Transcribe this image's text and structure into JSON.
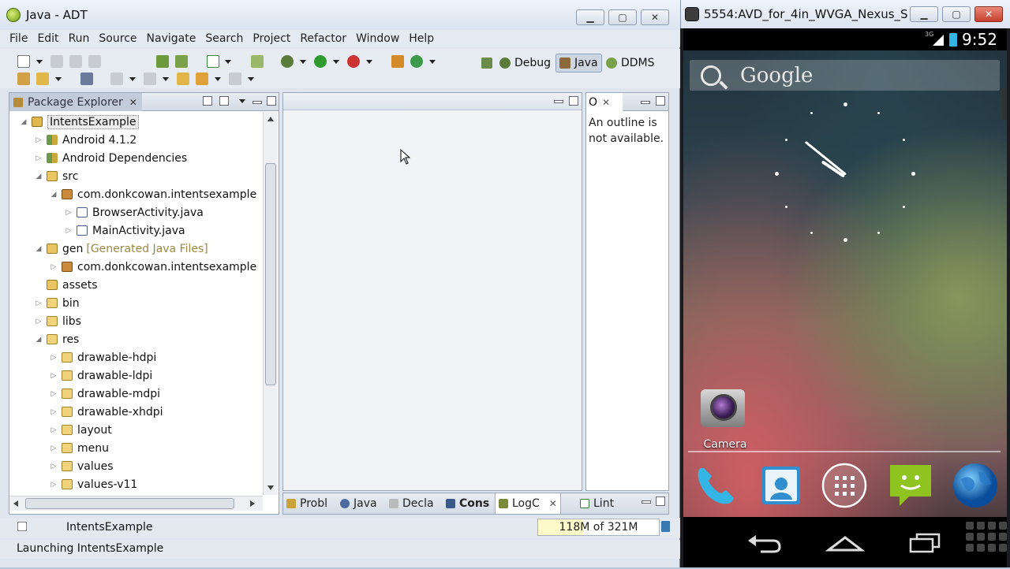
{
  "eclipse": {
    "title": "Java - ADT",
    "menu": [
      "File",
      "Edit",
      "Run",
      "Source",
      "Navigate",
      "Search",
      "Project",
      "Refactor",
      "Window",
      "Help"
    ],
    "perspectives": [
      "Debug",
      "Java",
      "DDMS"
    ],
    "package_explorer": {
      "title": "Package Explorer",
      "tree": [
        {
          "label": "IntentsExample",
          "depth": 0,
          "expanded": true,
          "icon": "project-icon"
        },
        {
          "label": "Android 4.1.2",
          "depth": 1,
          "expanded": false,
          "icon": "library-icon"
        },
        {
          "label": "Android Dependencies",
          "depth": 1,
          "expanded": false,
          "icon": "library-icon"
        },
        {
          "label": "src",
          "depth": 1,
          "expanded": true,
          "icon": "source-folder-icon"
        },
        {
          "label": "com.donkcowan.intentsexample",
          "depth": 2,
          "expanded": true,
          "icon": "package-icon"
        },
        {
          "label": "BrowserActivity.java",
          "depth": 3,
          "expanded": false,
          "icon": "java-file-icon"
        },
        {
          "label": "MainActivity.java",
          "depth": 3,
          "expanded": false,
          "icon": "java-file-icon"
        },
        {
          "label": "gen",
          "suffix": "[Generated Java Files]",
          "depth": 1,
          "expanded": true,
          "icon": "source-folder-icon"
        },
        {
          "label": "com.donkcowan.intentsexample",
          "depth": 2,
          "expanded": false,
          "icon": "package-icon"
        },
        {
          "label": "assets",
          "depth": 1,
          "expanded": null,
          "icon": "source-folder-icon"
        },
        {
          "label": "bin",
          "depth": 1,
          "expanded": false,
          "icon": "folder-icon"
        },
        {
          "label": "libs",
          "depth": 1,
          "expanded": false,
          "icon": "folder-icon"
        },
        {
          "label": "res",
          "depth": 1,
          "expanded": true,
          "icon": "folder-icon"
        },
        {
          "label": "drawable-hdpi",
          "depth": 2,
          "expanded": false,
          "icon": "folder-icon"
        },
        {
          "label": "drawable-ldpi",
          "depth": 2,
          "expanded": false,
          "icon": "folder-icon"
        },
        {
          "label": "drawable-mdpi",
          "depth": 2,
          "expanded": false,
          "icon": "folder-icon"
        },
        {
          "label": "drawable-xhdpi",
          "depth": 2,
          "expanded": false,
          "icon": "folder-icon"
        },
        {
          "label": "layout",
          "depth": 2,
          "expanded": false,
          "icon": "folder-icon"
        },
        {
          "label": "menu",
          "depth": 2,
          "expanded": false,
          "icon": "folder-icon"
        },
        {
          "label": "values",
          "depth": 2,
          "expanded": false,
          "icon": "folder-icon"
        },
        {
          "label": "values-v11",
          "depth": 2,
          "expanded": false,
          "icon": "folder-icon"
        }
      ]
    },
    "outline": {
      "tab_label": "O",
      "message": "An outline is not available."
    },
    "bottom_tabs": [
      "Probl",
      "Java",
      "Decla",
      "Cons",
      "LogC",
      "Lint"
    ],
    "status": {
      "selected": "IntentsExample",
      "heap": "118M of 321M",
      "heap_fraction": 0.37,
      "job": "Launching IntentsExample"
    }
  },
  "emulator": {
    "title": "5554:AVD_for_4in_WVGA_Nexus_S",
    "network": "3G",
    "time": "9:52",
    "search_text": "Google",
    "camera_label": "Camera",
    "dock": [
      "phone-icon",
      "contacts-icon",
      "apps-icon",
      "messaging-icon",
      "browser-icon"
    ],
    "nav": [
      "back-icon",
      "home-icon",
      "recents-icon"
    ]
  }
}
